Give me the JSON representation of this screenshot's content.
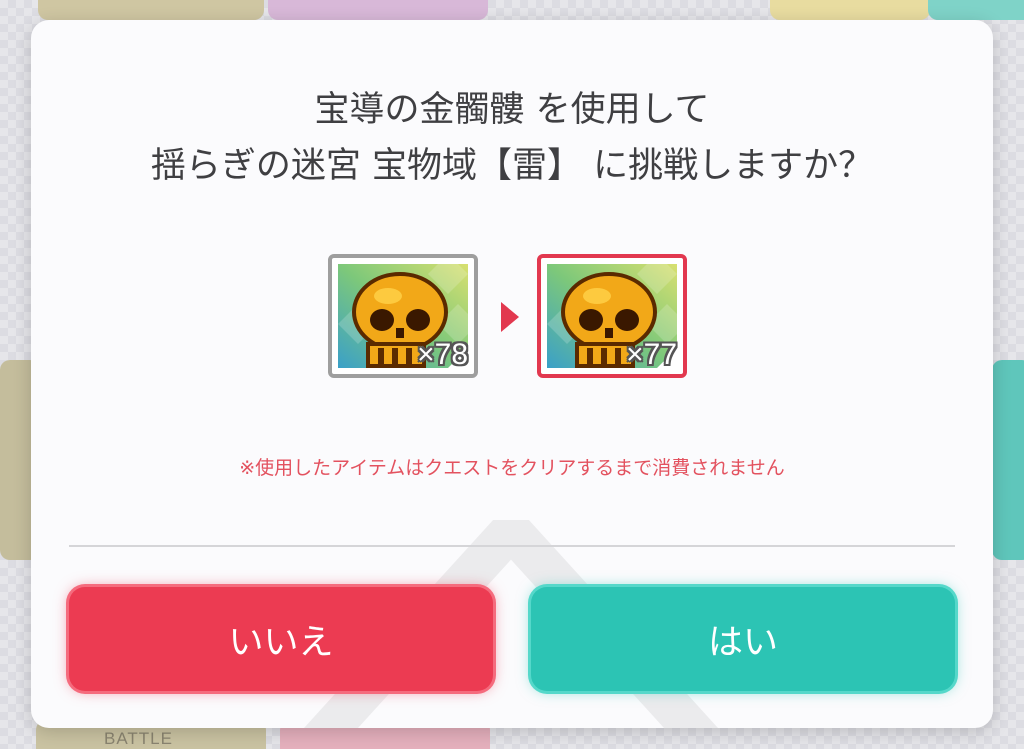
{
  "dialog": {
    "title_line1": "宝導の金髑髏 を使用して",
    "title_line2": "揺らぎの迷宮 宝物域【雷】 に挑戦しますか？",
    "item_before": {
      "name": "宝導の金髑髏",
      "count": "×78",
      "icon": "golden-skull-icon"
    },
    "item_after": {
      "name": "宝導の金髑髏",
      "count": "×77",
      "icon": "golden-skull-icon"
    },
    "note": "※使用したアイテムはクエストをクリアするまで消費されません",
    "no_label": "いいえ",
    "yes_label": "はい"
  },
  "background": {
    "bottom_label": "BATTLE"
  },
  "colors": {
    "accent_red": "#ec3b52",
    "accent_teal": "#2cc4b4",
    "note_text": "#e3525f",
    "title_text": "#3f3f42"
  }
}
